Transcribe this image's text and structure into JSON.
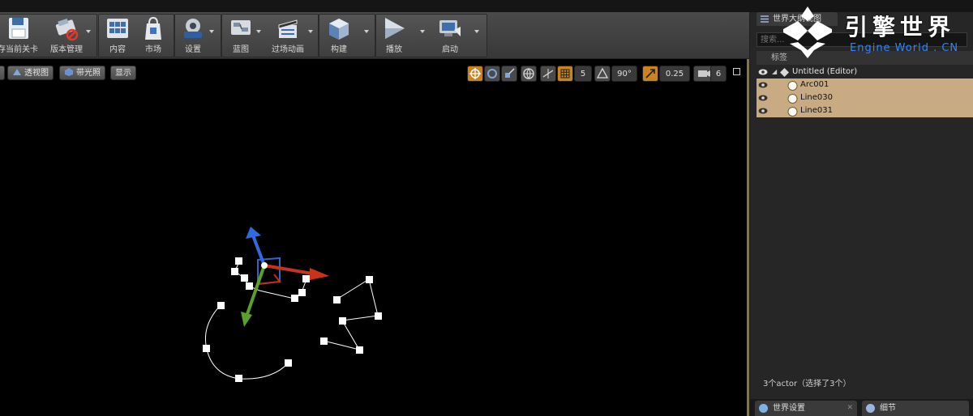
{
  "toolbar": {
    "buttons": [
      {
        "label": "存当前关卡",
        "icon": "save-icon"
      },
      {
        "label": "版本管理",
        "icon": "source-control-icon"
      },
      {
        "label": "内容",
        "icon": "content-browser-icon"
      },
      {
        "label": "市场",
        "icon": "marketplace-icon"
      },
      {
        "label": "设置",
        "icon": "settings-icon"
      },
      {
        "label": "蓝图",
        "icon": "blueprint-icon"
      },
      {
        "label": "过场动画",
        "icon": "cinematics-icon"
      },
      {
        "label": "构建",
        "icon": "build-icon"
      },
      {
        "label": "播放",
        "icon": "play-icon"
      },
      {
        "label": "启动",
        "icon": "launch-icon"
      }
    ]
  },
  "viewport": {
    "view_buttons": [
      {
        "label": "",
        "icon": "viewport-menu-icon"
      },
      {
        "label": "透视图",
        "icon": "perspective-icon"
      },
      {
        "label": "带光照",
        "icon": "lit-icon"
      },
      {
        "label": "显示",
        "icon": ""
      }
    ],
    "grid_snap": "5",
    "rotation_snap": "90°",
    "scale_snap": "0.25",
    "camera_speed": "6",
    "accent_color": "#c98320"
  },
  "outliner": {
    "tab_label": "世界大纲视图",
    "search_placeholder": "搜索...",
    "column_label": "标签",
    "items": [
      {
        "name": "Untitled (Editor)",
        "selected": false,
        "icon": "world-icon"
      },
      {
        "name": "Arc001",
        "selected": true,
        "icon": "actor-icon"
      },
      {
        "name": "Line030",
        "selected": true,
        "icon": "actor-icon"
      },
      {
        "name": "Line031",
        "selected": true,
        "icon": "actor-icon"
      }
    ],
    "actor_count": "3个actor（选择了3个）",
    "selection_color": "#c9ab83"
  },
  "bottom_tabs": [
    {
      "label": "世界设置",
      "icon": "globe-icon"
    },
    {
      "label": "细节",
      "icon": "details-icon"
    }
  ],
  "watermark": {
    "cn": "引擎世界",
    "en": "Engine World . CN",
    "en_color": "#2b86ff"
  }
}
